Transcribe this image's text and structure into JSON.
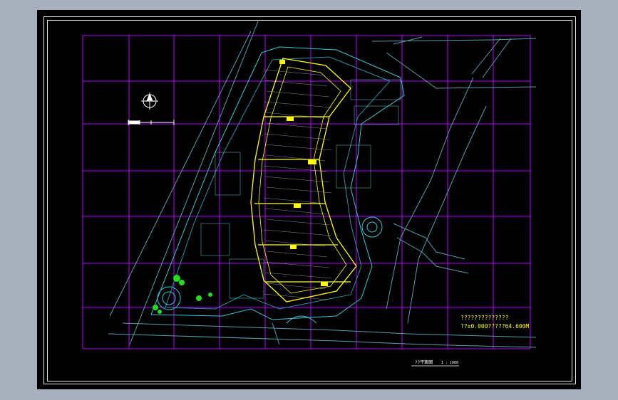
{
  "drawing": {
    "elevation_note_line1": "??????????????",
    "elevation_note_line2": "??±0.000?????64.600M",
    "title_label": "??平面图",
    "scale_label": "1 : 1000",
    "colors": {
      "background": "#000000",
      "grid": "#b400ff",
      "building": "#ffff00",
      "site_lines": "#00ffff",
      "frame": "#ffffff",
      "elevation_text": "#ffff00"
    }
  }
}
